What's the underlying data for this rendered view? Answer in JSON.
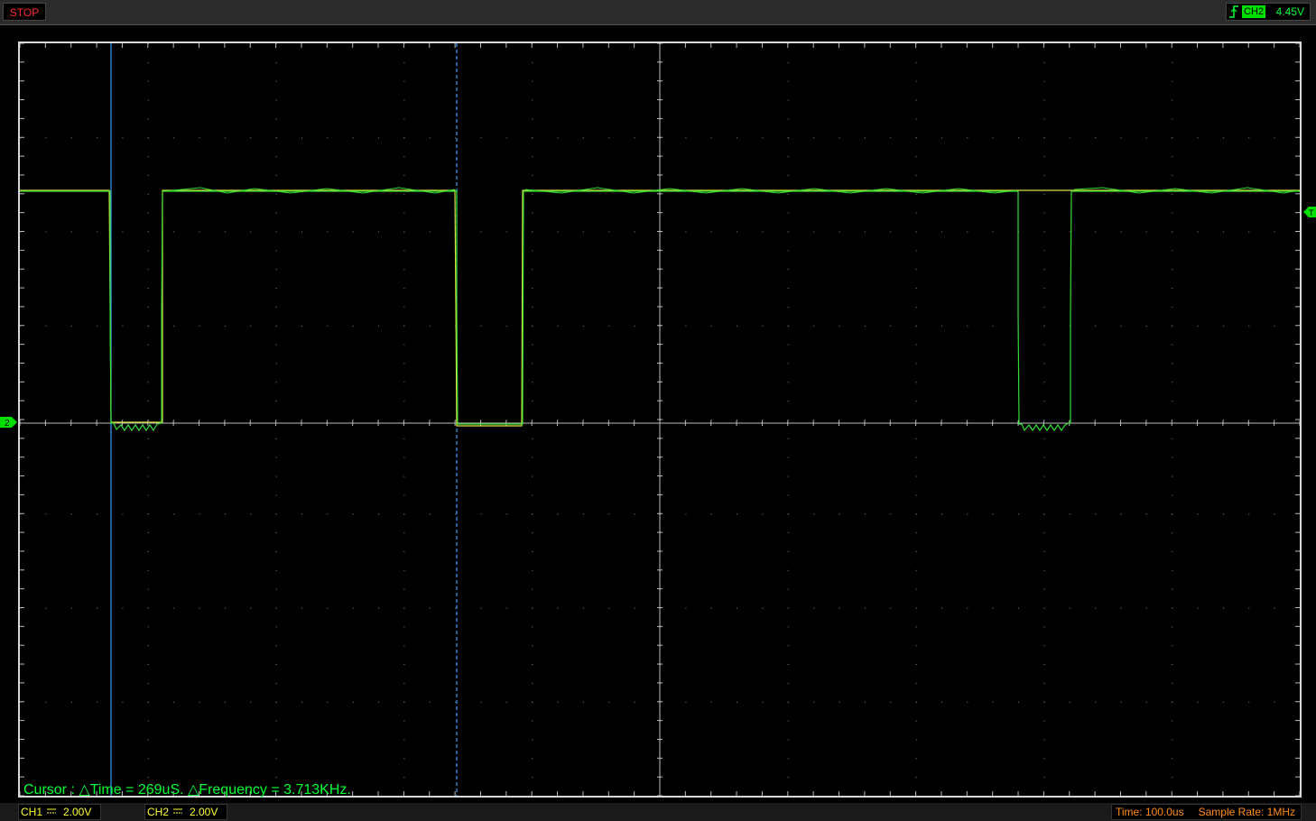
{
  "topbar": {
    "status": "STOP",
    "trigger": {
      "channel": "CH2",
      "level": "4.45V",
      "edge": "rising-edge-icon"
    }
  },
  "screen": {
    "ch2_marker": "2",
    "cursor_readout": "Cursor : △Time = 269uS. △Frequency = 3.713KHz."
  },
  "bottombar": {
    "ch1": {
      "name": "CH1",
      "volts": "2.00V"
    },
    "ch2": {
      "name": "CH2",
      "volts": "2.00V"
    },
    "timebase": "Time: 100.0us",
    "sample_rate": "Sample Rate: 1MHz"
  },
  "colors": {
    "trace_ch2": "#33dd33",
    "trace_ch1": "#e0e040",
    "cursor": "#3aa0ff",
    "status": "#ff2a2a",
    "readout": "#00ff33",
    "timebase": "#ff8c1a"
  }
}
